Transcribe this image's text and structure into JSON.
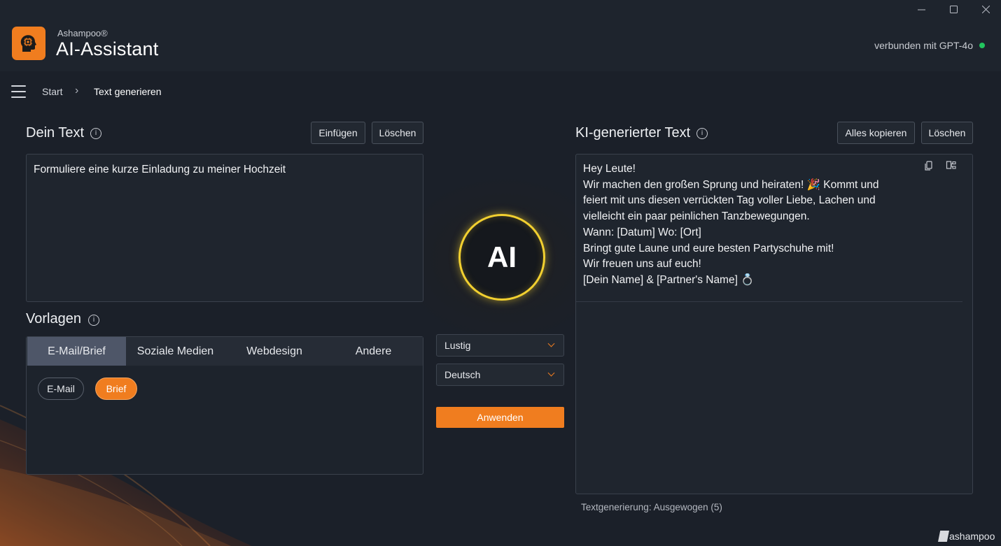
{
  "window": {
    "minimize_glyph": "—",
    "maximize_glyph": "☐",
    "close_glyph": "✕"
  },
  "header": {
    "brand_small": "Ashampoo®",
    "app_name": "AI-Assistant",
    "connection_status": "verbunden mit GPT-4o",
    "connection_color": "#22c55e"
  },
  "breadcrumb": {
    "home": "Start",
    "separator": "›",
    "current": "Text generieren"
  },
  "input_panel": {
    "title": "Dein Text",
    "insert_label": "Einfügen",
    "clear_label": "Löschen",
    "text": "Formuliere eine kurze Einladung zu meiner Hochzeit"
  },
  "templates": {
    "title": "Vorlagen",
    "tabs": [
      {
        "label": "E-Mail/Brief",
        "active": true
      },
      {
        "label": "Soziale Medien",
        "active": false
      },
      {
        "label": "Webdesign",
        "active": false
      },
      {
        "label": "Andere",
        "active": false
      }
    ],
    "chips": [
      {
        "label": "E-Mail",
        "selected": false
      },
      {
        "label": "Brief",
        "selected": true
      }
    ]
  },
  "center": {
    "ai_badge": "AI",
    "tone_select": "Lustig",
    "language_select": "Deutsch",
    "apply_label": "Anwenden"
  },
  "output_panel": {
    "title": "KI-generierter Text",
    "copy_all_label": "Alles kopieren",
    "clear_label": "Löschen",
    "lines": [
      "Hey Leute!",
      "Wir machen den großen Sprung und heiraten! 🎉  Kommt und",
      "feiert mit uns diesen verrückten Tag voller Liebe, Lachen und",
      "vielleicht ein paar peinlichen Tanzbewegungen.",
      "Wann: [Datum] Wo: [Ort]",
      "Bringt gute Laune und eure besten Partyschuhe mit!",
      "Wir freuen uns auf euch!",
      "[Dein Name] & [Partner's Name] 💍"
    ],
    "status": "Textgenerierung: Ausgewogen (5)"
  },
  "footer": {
    "brand": "ashampoo"
  },
  "colors": {
    "accent": "#f07d1f",
    "background": "#1b2029",
    "panel": "#1f252e",
    "ai_ring": "#f2d030"
  }
}
